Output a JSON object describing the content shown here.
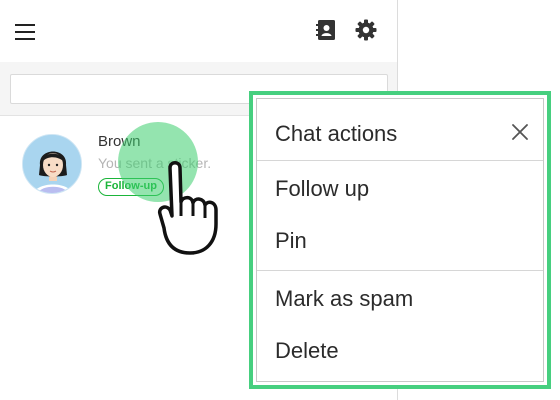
{
  "header": {
    "menu_icon": "hamburger-icon",
    "contacts_icon": "contacts-book-icon",
    "settings_icon": "gear-icon"
  },
  "search": {
    "value": "",
    "placeholder": ""
  },
  "chats": [
    {
      "name": "Brown",
      "preview": "You sent a sticker.",
      "tag": "Follow-up",
      "avatar_icon": "user-avatar-icon"
    }
  ],
  "context_menu": {
    "title": "Chat actions",
    "close_icon": "close-icon",
    "items": [
      {
        "label": "Follow up"
      },
      {
        "label": "Pin"
      },
      {
        "label": "Mark as spam"
      },
      {
        "label": "Delete"
      }
    ]
  },
  "colors": {
    "accent_green": "#1bb53a",
    "highlight_frame": "#46cf7f",
    "avatar_bg": "#a9d5ef"
  }
}
